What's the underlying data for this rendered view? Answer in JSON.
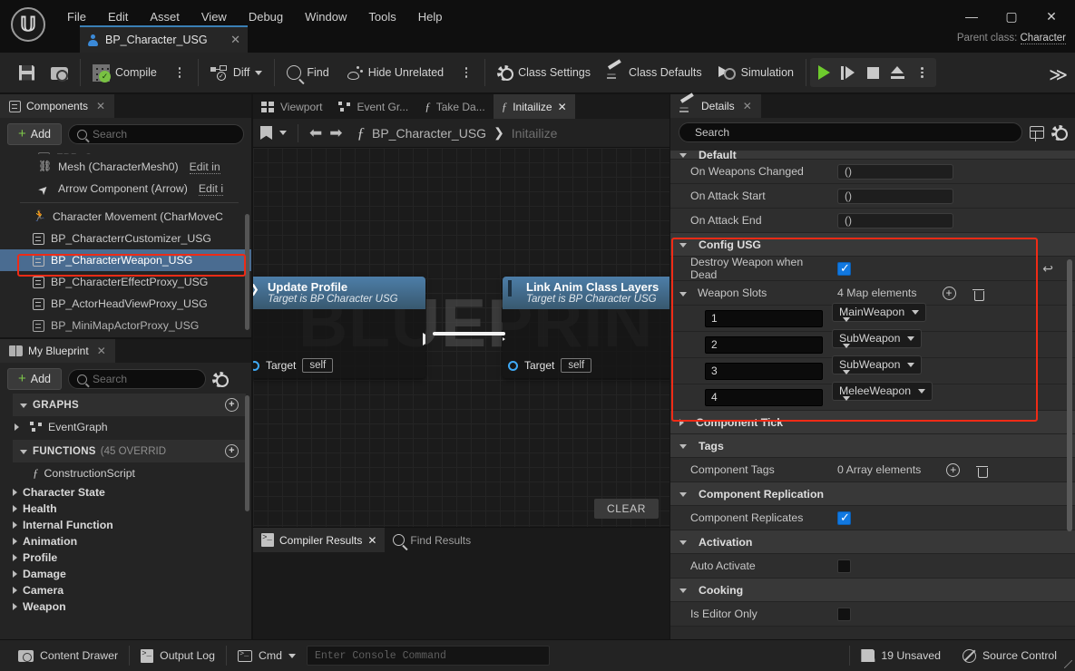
{
  "titlebar": {
    "menu": [
      "File",
      "Edit",
      "Asset",
      "View",
      "Debug",
      "Window",
      "Tools",
      "Help"
    ],
    "asset_tab": "BP_Character_USG",
    "parent_class_label": "Parent class:",
    "parent_class_value": "Character",
    "window_minimize": "—",
    "window_maximize": "▢",
    "window_close": "✕",
    "tab_close": "✕"
  },
  "toolbar": {
    "save": "Save",
    "browse": "Browse",
    "compile": "Compile",
    "diff": "Diff",
    "find": "Find",
    "hide_unrelated": "Hide Unrelated",
    "class_settings": "Class Settings",
    "class_defaults": "Class Defaults",
    "simulation": "Simulation",
    "play": "Play",
    "step": "Step",
    "stop": "Stop",
    "eject": "Eject",
    "overflow": "≫"
  },
  "components": {
    "tab_label": "Components",
    "add_label": "Add",
    "search_placeholder": "Search",
    "items": [
      {
        "label": "Mesh (CharacterMesh0)",
        "edit": "Edit in",
        "icon": "mesh-icon",
        "selected": false,
        "indent": 1
      },
      {
        "label": "Arrow Component (Arrow)",
        "edit": "Edit i",
        "icon": "arrow-icon",
        "selected": false,
        "indent": 1
      },
      {
        "label": "Character Movement (CharMoveC",
        "edit": "",
        "icon": "movement-icon",
        "selected": false,
        "indent": 0
      },
      {
        "label": "BP_CharacterrCustomizer_USG",
        "edit": "",
        "icon": "blueprint-icon",
        "selected": false,
        "indent": 0
      },
      {
        "label": "BP_CharacterWeapon_USG",
        "edit": "",
        "icon": "blueprint-icon",
        "selected": true,
        "indent": 0
      },
      {
        "label": "BP_CharacterEffectProxy_USG",
        "edit": "",
        "icon": "blueprint-icon",
        "selected": false,
        "indent": 0
      },
      {
        "label": "BP_ActorHeadViewProxy_USG",
        "edit": "",
        "icon": "blueprint-icon",
        "selected": false,
        "indent": 0
      },
      {
        "label": "BP_MiniMapActorProxy_USG",
        "edit": "",
        "icon": "blueprint-icon",
        "selected": false,
        "indent": 0
      }
    ]
  },
  "myblueprint": {
    "tab_label": "My Blueprint",
    "add_label": "Add",
    "search_placeholder": "Search",
    "graphs_header": "GRAPHS",
    "graphs": [
      "EventGraph"
    ],
    "functions_header": "FUNCTIONS",
    "functions_count": "(45 OVERRID",
    "functions": [
      "ConstructionScript"
    ],
    "categories": [
      "Character State",
      "Health",
      "Internal Function",
      "Animation",
      "Profile",
      "Damage",
      "Camera",
      "Weapon"
    ]
  },
  "graph": {
    "tabs": [
      {
        "label": "Viewport",
        "icon": "viewport-icon",
        "active": false,
        "closable": false
      },
      {
        "label": "Event Gr...",
        "icon": "graph-icon",
        "active": false,
        "closable": false
      },
      {
        "label": "Take Da...",
        "icon": "function-icon",
        "active": false,
        "closable": false
      },
      {
        "label": "Initailize",
        "icon": "function-icon",
        "active": true,
        "closable": true
      }
    ],
    "breadcrumb_root": "BP_Character_USG",
    "breadcrumb_sep": "❯",
    "breadcrumb_current": "Initailize",
    "watermark": "BLUEPRINT",
    "nodes": [
      {
        "title": "Update Profile",
        "subtitle": "Target is BP Character USG",
        "target_label": "Target",
        "target_value": "self"
      },
      {
        "title": "Link Anim Class Layers",
        "subtitle": "Target is BP Character USG",
        "target_label": "Target",
        "target_value": "self"
      }
    ],
    "clear_button": "CLEAR",
    "bottom_tabs": [
      {
        "label": "Compiler Results",
        "active": true,
        "closable": true
      },
      {
        "label": "Find Results",
        "active": false,
        "closable": false
      }
    ]
  },
  "details": {
    "tab_label": "Details",
    "search_placeholder": "Search",
    "sections": [
      {
        "type": "section",
        "name": "Default",
        "expanded": true,
        "partial": true
      },
      {
        "type": "row",
        "label": "On Weapons Changed",
        "value": "()",
        "control": "pill"
      },
      {
        "type": "row",
        "label": "On Attack Start",
        "value": "()",
        "control": "pill"
      },
      {
        "type": "row",
        "label": "On Attack End",
        "value": "()",
        "control": "pill"
      },
      {
        "type": "section",
        "name": "Config USG",
        "expanded": true
      },
      {
        "type": "row",
        "label": "Destroy Weapon when Dead",
        "value": "",
        "control": "checkbox-on",
        "reset": "↩"
      },
      {
        "type": "row",
        "label": "Weapon Slots",
        "value": "4 Map elements",
        "control": "map-header",
        "expandable": true
      },
      {
        "type": "section",
        "name": "Component Tick",
        "expanded": false
      },
      {
        "type": "section",
        "name": "Tags",
        "expanded": true
      },
      {
        "type": "row",
        "label": "Component Tags",
        "value": "0 Array elements",
        "control": "array-header"
      },
      {
        "type": "section",
        "name": "Component Replication",
        "expanded": true
      },
      {
        "type": "row",
        "label": "Component Replicates",
        "value": "",
        "control": "checkbox-on"
      },
      {
        "type": "section",
        "name": "Activation",
        "expanded": true
      },
      {
        "type": "row",
        "label": "Auto Activate",
        "value": "",
        "control": "checkbox-off"
      },
      {
        "type": "section",
        "name": "Cooking",
        "expanded": true
      },
      {
        "type": "row",
        "label": "Is Editor Only",
        "value": "",
        "control": "checkbox-off"
      }
    ],
    "weapon_slots": [
      {
        "key": "1",
        "value": "MainWeapon"
      },
      {
        "key": "2",
        "value": "SubWeapon"
      },
      {
        "key": "3",
        "value": "SubWeapon"
      },
      {
        "key": "4",
        "value": "MeleeWeapon"
      }
    ],
    "highlight_color": "#f02b16"
  },
  "statusbar": {
    "content_drawer": "Content Drawer",
    "output_log": "Output Log",
    "cmd": "Cmd",
    "cmd_placeholder": "Enter Console Command",
    "unsaved": "19 Unsaved",
    "source_control": "Source Control"
  }
}
